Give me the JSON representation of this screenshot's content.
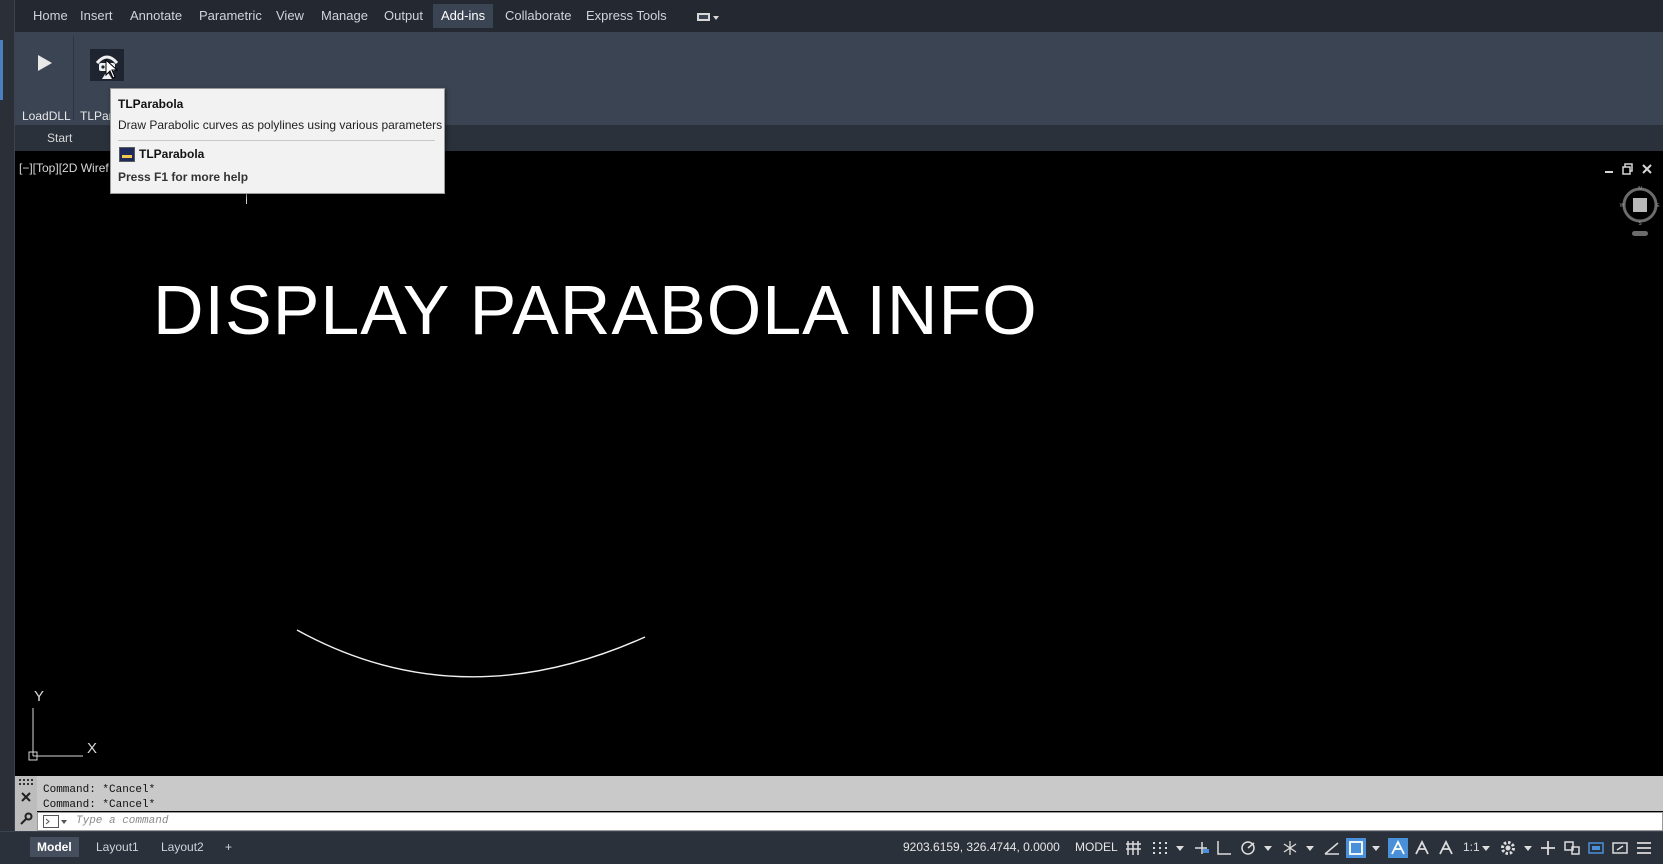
{
  "ribbon_tabs": [
    "Home",
    "Insert",
    "Annotate",
    "Parametric",
    "View",
    "Manage",
    "Output",
    "Add-ins",
    "Collaborate",
    "Express Tools"
  ],
  "active_tab": "Add-ins",
  "ribbon": {
    "load_dll_label": "LoadDLL",
    "tlparabola_label": "TLPara"
  },
  "file_tabs": {
    "start_label": "Start"
  },
  "viewport": {
    "label": "[−][Top][2D Wiref",
    "drawing_text": "DISPLAY PARABOLA INFO",
    "ucs_x_label": "X",
    "ucs_y_label": "Y"
  },
  "tooltip": {
    "title": "TLParabola",
    "description": "Draw Parabolic curves as polylines using various parameters",
    "command_name": "TLParabola",
    "help_text": "Press F1 for more help"
  },
  "command_line": {
    "history": [
      "Command: *Cancel*",
      "Command: *Cancel*"
    ],
    "placeholder": "Type a command"
  },
  "status_bar": {
    "layout_tabs": [
      "Model",
      "Layout1",
      "Layout2"
    ],
    "add_layout": "+",
    "coordinates": "9203.6159, 326.4744, 0.0000",
    "space_button": "MODEL",
    "annotation_scale": "1:1"
  },
  "colors": {
    "ribbon_bg": "#3b4453",
    "tab_bg": "#232831",
    "drawing_bg": "#000000",
    "accent": "#4a90d9"
  }
}
